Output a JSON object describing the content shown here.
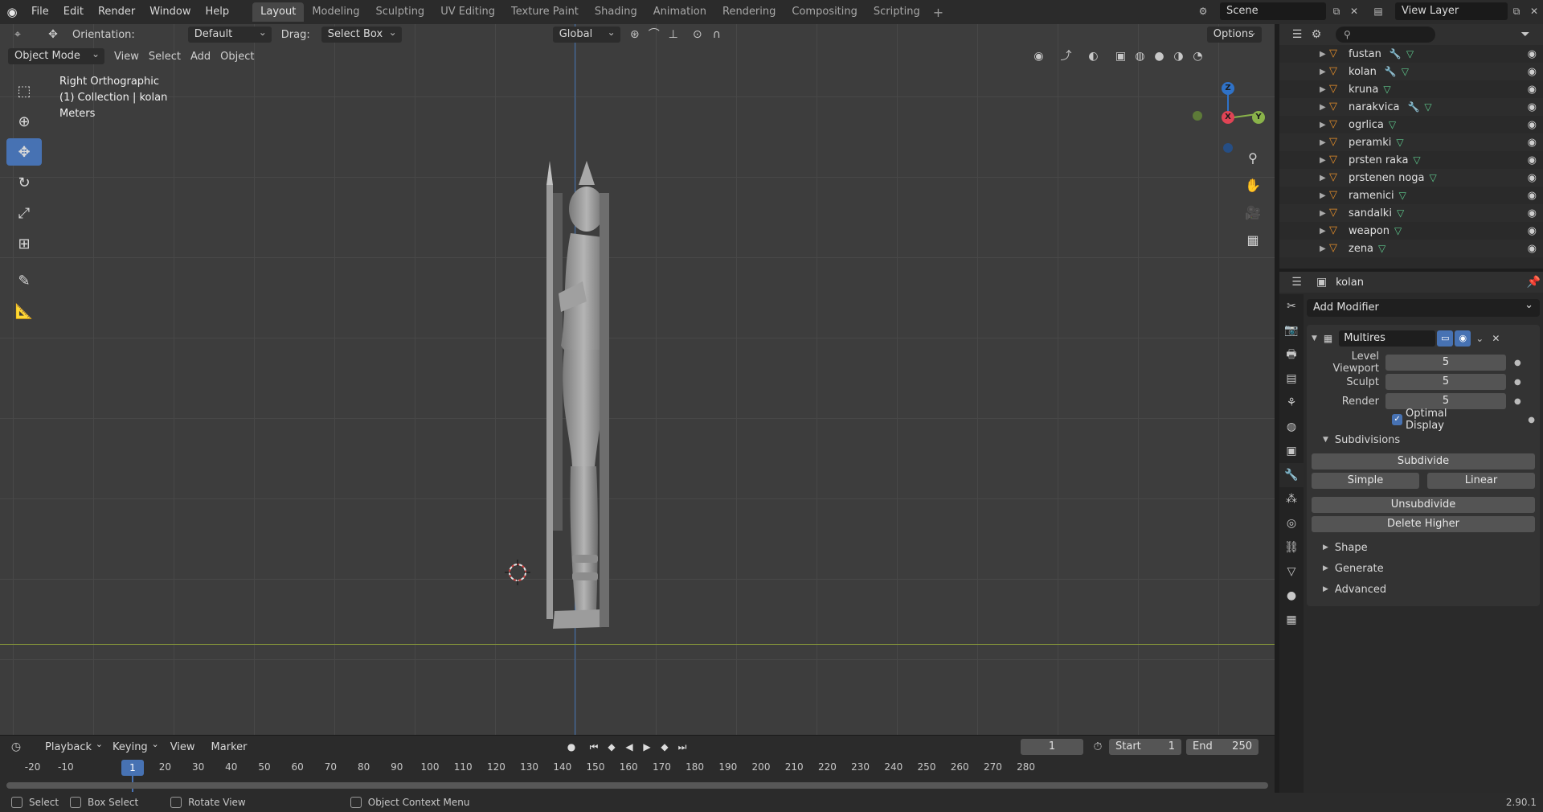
{
  "topbar": {
    "menus": [
      "File",
      "Edit",
      "Render",
      "Window",
      "Help"
    ],
    "workspaces": [
      "Layout",
      "Modeling",
      "Sculpting",
      "UV Editing",
      "Texture Paint",
      "Shading",
      "Animation",
      "Rendering",
      "Compositing",
      "Scripting"
    ],
    "active_workspace": "Layout",
    "scene": "Scene",
    "view_layer": "View Layer"
  },
  "viewport_header": {
    "orientation_label": "Orientation:",
    "orientation_value": "Default",
    "drag_label": "Drag:",
    "drag_value": "Select Box",
    "transform_orientation": "Global",
    "options_label": "Options",
    "mode": "Object Mode",
    "menus": [
      "View",
      "Select",
      "Add",
      "Object"
    ]
  },
  "viewport_info": {
    "view_name": "Right Orthographic",
    "collection": "(1) Collection | kolan",
    "units": "Meters"
  },
  "gizmo": {
    "z": "Z",
    "x": "X",
    "y": "Y"
  },
  "outliner": {
    "search_placeholder": "",
    "items": [
      {
        "name": "fustan",
        "wrench": true
      },
      {
        "name": "kolan",
        "wrench": true
      },
      {
        "name": "kruna",
        "wrench": false
      },
      {
        "name": "narakvica",
        "wrench": true
      },
      {
        "name": "ogrlica",
        "wrench": false
      },
      {
        "name": "peramki",
        "wrench": false
      },
      {
        "name": "prsten raka",
        "wrench": false
      },
      {
        "name": "prstenen noga",
        "wrench": false
      },
      {
        "name": "ramenici",
        "wrench": false
      },
      {
        "name": "sandalki",
        "wrench": false
      },
      {
        "name": "weapon",
        "wrench": false
      },
      {
        "name": "zena",
        "wrench": false
      }
    ]
  },
  "properties": {
    "object_name": "kolan",
    "add_modifier": "Add Modifier",
    "modifier_name": "Multires",
    "fields": [
      {
        "label": "Level Viewport",
        "value": "5"
      },
      {
        "label": "Sculpt",
        "value": "5"
      },
      {
        "label": "Render",
        "value": "5"
      }
    ],
    "optimal_display": "Optimal Display",
    "subdivisions": "Subdivisions",
    "subdivide": "Subdivide",
    "simple": "Simple",
    "linear": "Linear",
    "unsubdivide": "Unsubdivide",
    "delete_higher": "Delete Higher",
    "sections": [
      "Shape",
      "Generate",
      "Advanced"
    ]
  },
  "timeline": {
    "menus": [
      "Playback",
      "Keying",
      "View",
      "Marker"
    ],
    "current_frame": "1",
    "start_label": "Start",
    "start": "1",
    "end_label": "End",
    "end": "250",
    "ticks": [
      "-20",
      "-10",
      "1",
      "10",
      "20",
      "30",
      "40",
      "50",
      "60",
      "70",
      "80",
      "90",
      "100",
      "110",
      "120",
      "130",
      "140",
      "150",
      "160",
      "170",
      "180",
      "190",
      "200",
      "210",
      "220",
      "230",
      "240",
      "250",
      "260",
      "270",
      "280"
    ],
    "playhead": "1"
  },
  "statusbar": {
    "select": "Select",
    "box_select": "Box Select",
    "rotate_view": "Rotate View",
    "context_menu": "Object Context Menu",
    "version": "2.90.1"
  }
}
